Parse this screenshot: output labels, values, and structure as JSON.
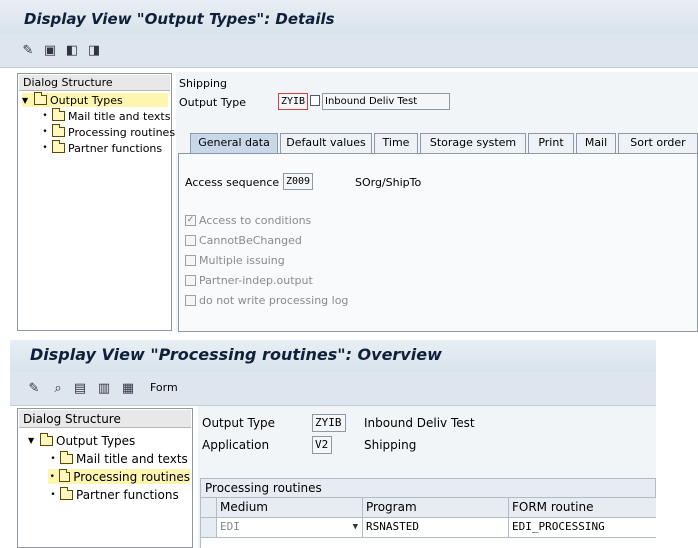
{
  "top": {
    "title": "Display View \"Output Types\": Details",
    "toolbar_icons": [
      "display-change-icon",
      "save-icon",
      "prev-entry-icon",
      "next-entry-icon"
    ],
    "dialog_structure": {
      "header": "Dialog Structure",
      "items": [
        {
          "label": "Output Types",
          "selected": true
        },
        {
          "label": "Mail title and texts"
        },
        {
          "label": "Processing routines"
        },
        {
          "label": "Partner functions"
        }
      ]
    },
    "section_label": "Shipping",
    "output_type_label": "Output Type",
    "output_type_value": "ZYIB",
    "output_type_desc": "Inbound Deliv Test",
    "tabs": [
      "General data",
      "Default values",
      "Time",
      "Storage system",
      "Print",
      "Mail",
      "Sort order"
    ],
    "access_sequence_label": "Access sequence",
    "access_sequence_value": "Z009",
    "access_sequence_desc": "SOrg/ShipTo",
    "checkboxes": [
      {
        "label": "Access to conditions",
        "checked": true
      },
      {
        "label": "CannotBeChanged",
        "checked": false
      },
      {
        "label": "Multiple issuing",
        "checked": false
      },
      {
        "label": "Partner-indep.output",
        "checked": false
      },
      {
        "label": "do not write processing log",
        "checked": false
      }
    ]
  },
  "bottom": {
    "title": "Display View \"Processing routines\": Overview",
    "toolbar_icons": [
      "display-change-icon",
      "find-icon",
      "select-all-icon",
      "select-block-icon",
      "deselect-icon"
    ],
    "form_label": "Form",
    "dialog_structure": {
      "header": "Dialog Structure",
      "items": [
        {
          "label": "Output Types"
        },
        {
          "label": "Mail title and texts"
        },
        {
          "label": "Processing routines",
          "selected": true
        },
        {
          "label": "Partner functions"
        }
      ]
    },
    "output_type_label": "Output Type",
    "output_type_value": "ZYIB",
    "output_type_desc": "Inbound Deliv Test",
    "application_label": "Application",
    "application_value": "V2",
    "application_desc": "Shipping",
    "grid_title": "Processing routines",
    "columns": [
      "Medium",
      "Program",
      "FORM routine"
    ],
    "rows": [
      {
        "medium": "EDI",
        "program": "RSNASTED",
        "form": "EDI_PROCESSING"
      }
    ]
  },
  "colors": {
    "title_bar": "#dde6ee",
    "selected_tree": "#fef5b0",
    "active_tab": "#c8d8e8"
  }
}
